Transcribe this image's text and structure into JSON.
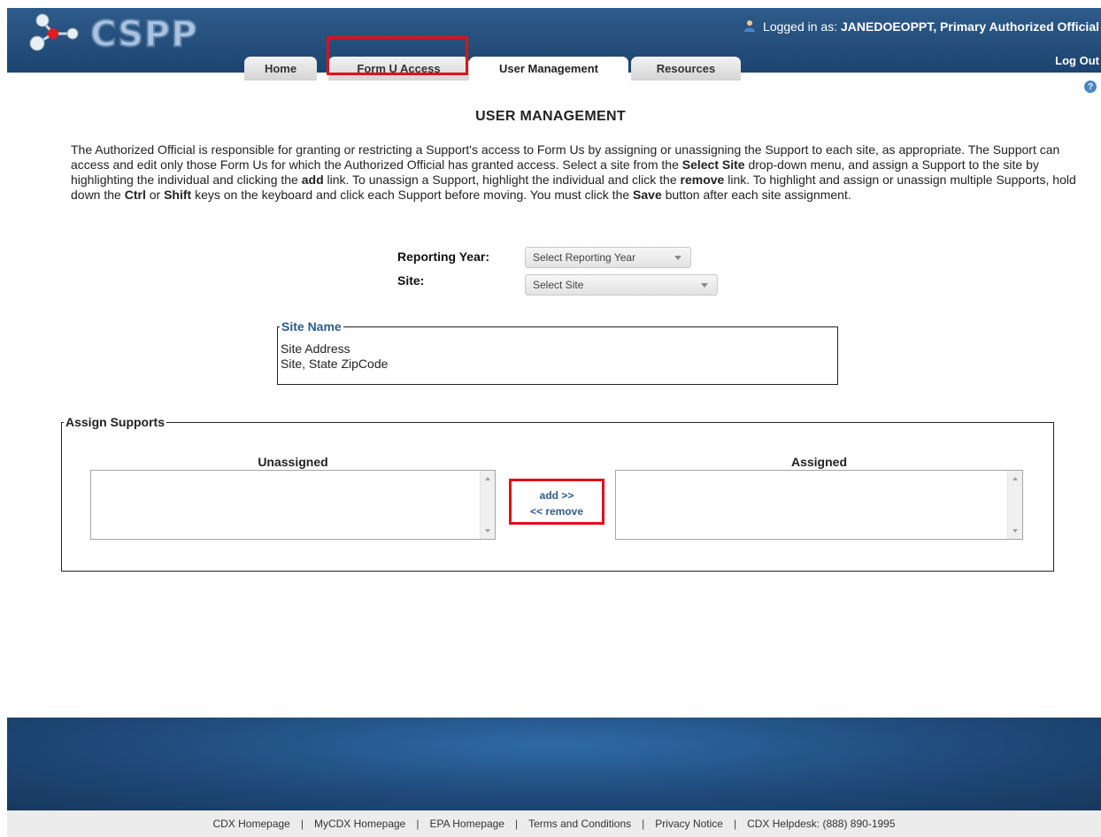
{
  "header": {
    "logo_text": "CSPP",
    "login_prefix": "Logged in as:",
    "login_user": "JANEDOEOPPT, Primary Authorized Official",
    "logout_label": "Log Out",
    "tabs": [
      {
        "label": "Home",
        "active": false
      },
      {
        "label": "Form U Access",
        "active": false,
        "highlighted": true
      },
      {
        "label": "User Management",
        "active": true
      },
      {
        "label": "Resources",
        "active": false
      }
    ]
  },
  "page": {
    "title": "USER MANAGEMENT",
    "intro": {
      "p1": "The Authorized Official is responsible for granting or restricting a Support's access to Form Us by assigning or unassigning the Support to each site, as appropriate. The Support can access and edit only those Form Us for which the Authorized Official has granted access. Select a site from the ",
      "b1": "Select Site",
      "p2": " drop-down menu, and assign a Support to the site by highlighting the individual and clicking the ",
      "b2": "add",
      "p3": " link. To unassign a Support, highlight the individual and click the ",
      "b3": "remove",
      "p4": " link. To highlight and assign or unassign multiple Supports, hold down the ",
      "b4": "Ctrl",
      "p5": " or ",
      "b5": "Shift",
      "p6": " keys on the keyboard and click each Support before moving. You must click the ",
      "b6": "Save",
      "p7": " button after each site assignment."
    },
    "reporting_year_label": "Reporting Year:",
    "reporting_year_value": "Select Reporting Year",
    "site_label": "Site:",
    "site_value": "Select Site",
    "site_box": {
      "legend": "Site Name",
      "address": "Site Address",
      "city_line": "Site, State ZipCode"
    },
    "assign": {
      "legend": "Assign Supports",
      "unassigned_label": "Unassigned",
      "assigned_label": "Assigned",
      "add_label": "add >>",
      "remove_label": "<< remove",
      "unassigned_items": [],
      "assigned_items": []
    }
  },
  "footer": {
    "links": [
      "CDX Homepage",
      "MyCDX Homepage",
      "EPA Homepage",
      "Terms and Conditions",
      "Privacy Notice",
      "CDX Helpdesk: (888) 890-1995"
    ],
    "separator": "|"
  },
  "colors": {
    "header_bg": "#2e5b8a",
    "highlight": "#e0101a",
    "link": "#2e5b8a"
  }
}
